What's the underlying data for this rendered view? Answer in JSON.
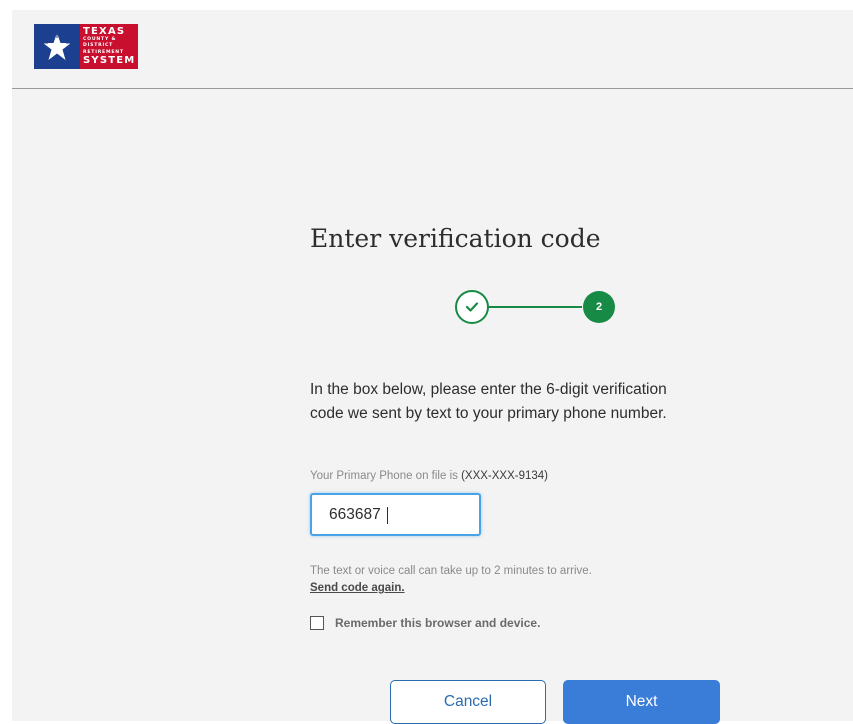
{
  "header": {
    "logo": {
      "line1": "TEXAS",
      "line2": "COUNTY &",
      "line3": "DISTRICT",
      "line4": "RETIREMENT",
      "line5": "SYSTEM",
      "colors": {
        "blue": "#1c3f8f",
        "red": "#c8102e"
      }
    }
  },
  "main": {
    "title": "Enter verification code",
    "stepper": {
      "step1_state": "complete",
      "step2_label": "2",
      "color": "#178b45"
    },
    "instructions": "In the box below, please enter the 6-digit verification code we sent by text to your primary phone number.",
    "phone_info_prefix": "Your Primary Phone on file is",
    "phone_number": "(XXX-XXX-9134)",
    "code_value": "663687",
    "helper_text": "The text or voice call can take up to 2 minutes to arrive.",
    "resend_link": "Send code again.",
    "remember_label": "Remember this browser and device.",
    "remember_checked": false
  },
  "buttons": {
    "cancel_label": "Cancel",
    "next_label": "Next",
    "accent": "#3a7dd8"
  }
}
